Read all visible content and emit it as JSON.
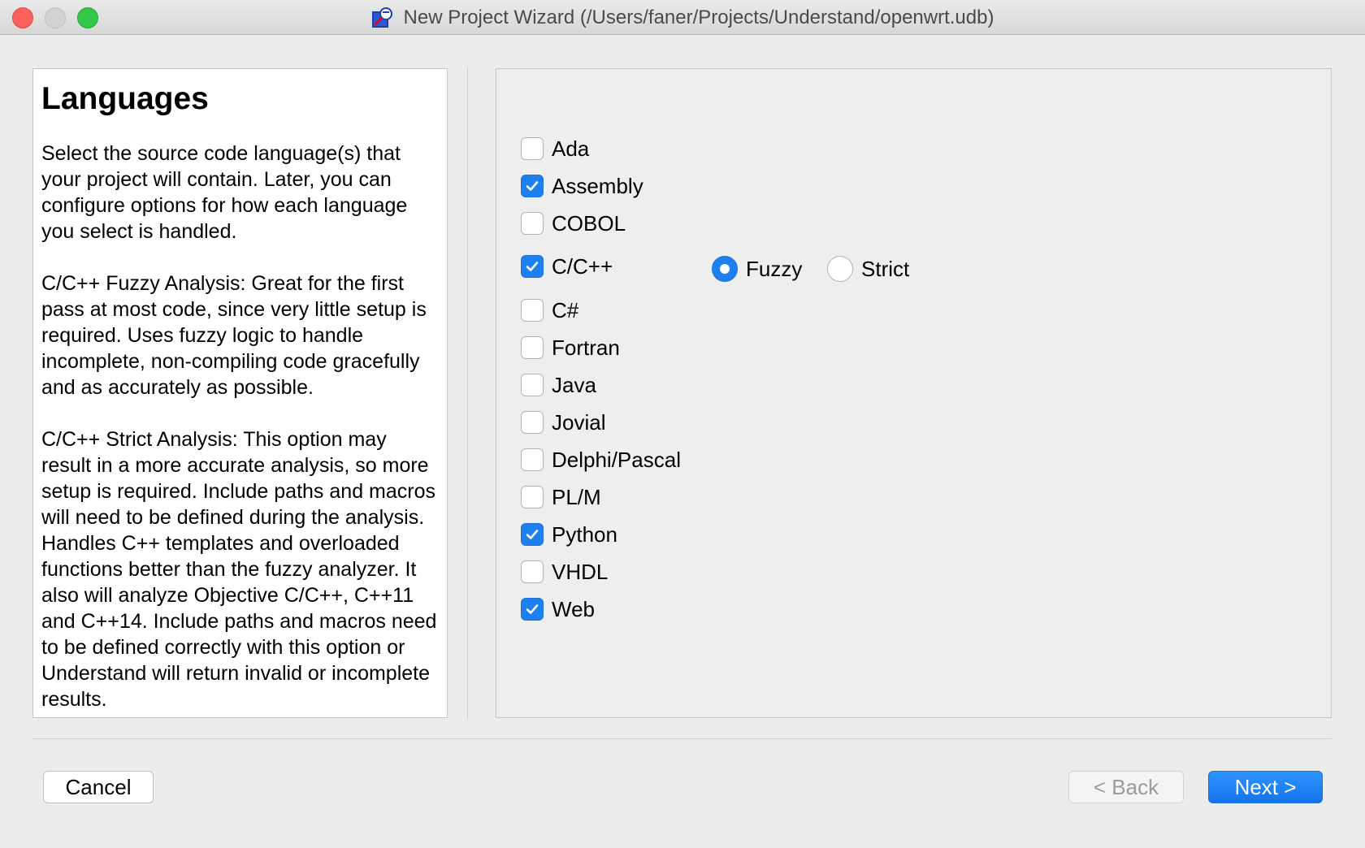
{
  "window": {
    "title": "New Project Wizard (/Users/faner/Projects/Understand/openwrt.udb)"
  },
  "help": {
    "heading": "Languages",
    "paragraphs": [
      "Select the source code language(s) that your project will contain. Later, you can configure options for how each language you select is handled.",
      "C/C++ Fuzzy Analysis: Great for the first pass at most code, since very little setup is required. Uses fuzzy logic to handle incomplete, non-compiling code gracefully and as accurately as possible.",
      "C/C++ Strict Analysis: This option may result in a more accurate analysis, so more setup is required. Include paths and macros will need to be defined during the analysis. Handles C++ templates and overloaded functions better than the fuzzy analyzer. It also will analyze Objective C/C++, C++11 and C++14. Include paths and macros need to be defined correctly with this option or Understand will return invalid or incomplete results."
    ]
  },
  "languages": [
    {
      "label": "Ada",
      "checked": false
    },
    {
      "label": "Assembly",
      "checked": true
    },
    {
      "label": "COBOL",
      "checked": false
    },
    {
      "label": "C/C++",
      "checked": true
    },
    {
      "label": "C#",
      "checked": false
    },
    {
      "label": "Fortran",
      "checked": false
    },
    {
      "label": "Java",
      "checked": false
    },
    {
      "label": "Jovial",
      "checked": false
    },
    {
      "label": "Delphi/Pascal",
      "checked": false
    },
    {
      "label": "PL/M",
      "checked": false
    },
    {
      "label": "Python",
      "checked": true
    },
    {
      "label": "VHDL",
      "checked": false
    },
    {
      "label": "Web",
      "checked": true
    }
  ],
  "cpp_mode": {
    "fuzzy_label": "Fuzzy",
    "strict_label": "Strict",
    "selected": "Fuzzy"
  },
  "buttons": {
    "cancel": "Cancel",
    "back": "< Back",
    "next": "Next >"
  },
  "colors": {
    "accent": "#1e7ff0",
    "close": "#fc605c",
    "maximize": "#34c84a"
  }
}
